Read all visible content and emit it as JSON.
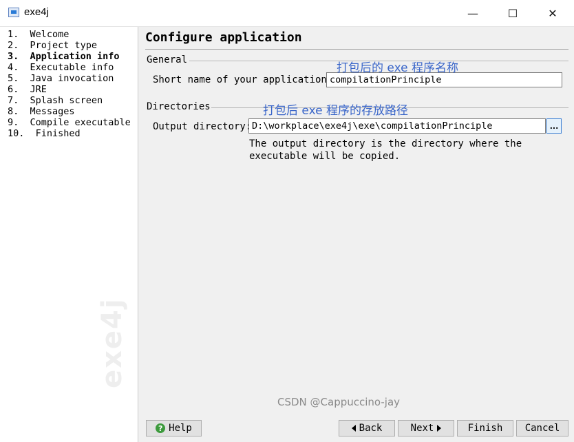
{
  "window": {
    "title": "exe4j",
    "minimize": "—",
    "maximize": "☐",
    "close": "✕"
  },
  "sidebar": {
    "steps": [
      {
        "label": "1.  Welcome"
      },
      {
        "label": "2.  Project type"
      },
      {
        "label": "3.  Application info",
        "active": true
      },
      {
        "label": "4.  Executable info"
      },
      {
        "label": "5.  Java invocation"
      },
      {
        "label": "6.  JRE"
      },
      {
        "label": "7.  Splash screen"
      },
      {
        "label": "8.  Messages"
      },
      {
        "label": "9.  Compile executable"
      },
      {
        "label": "10.  Finished"
      }
    ],
    "watermark": "exe4j"
  },
  "main": {
    "title": "Configure application",
    "general": {
      "section_label": "General",
      "short_name_label": "Short name of your application:",
      "short_name_value": "compilationPrinciple"
    },
    "directories": {
      "section_label": "Directories",
      "output_label": "Output directory:",
      "output_value": "D:\\workplace\\exe4j\\exe\\compilationPrinciple",
      "browse_label": "...",
      "note": "The output directory is the directory where the executable will be copied."
    }
  },
  "annotations": {
    "short_name": "打包后的 exe 程序名称",
    "output_dir": "打包后 exe 程序的存放路径"
  },
  "buttons": {
    "help": "Help",
    "back": "Back",
    "next": "Next",
    "finish": "Finish",
    "cancel": "Cancel"
  },
  "watermark_text": "CSDN @Cappuccino-jay",
  "icons": {
    "help": "help-icon",
    "back": "arrow-left-icon",
    "next": "arrow-right-icon"
  },
  "colors": {
    "annotation": "#3a66c9",
    "help_icon": "#3c9a3c",
    "browse_border": "#3c7fd4"
  }
}
